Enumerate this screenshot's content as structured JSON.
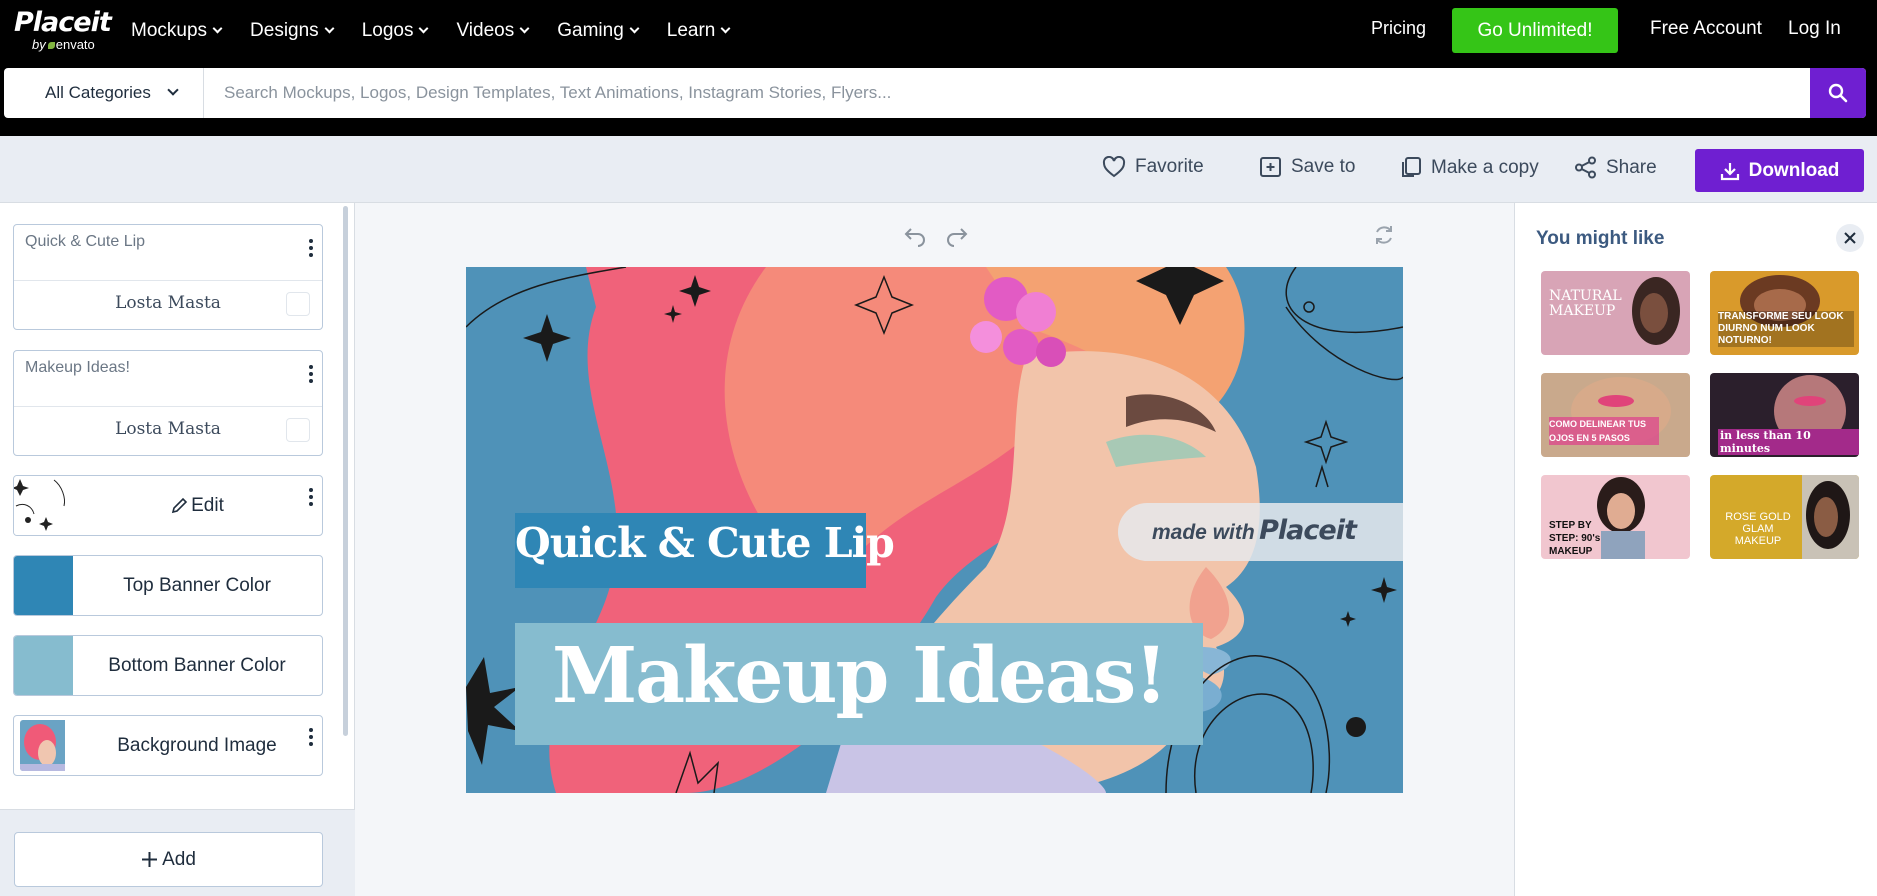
{
  "nav": {
    "logo_main": "Placeit",
    "logo_sub": "envato",
    "logo_by": "by",
    "menu": [
      "Mockups",
      "Designs",
      "Logos",
      "Videos",
      "Gaming",
      "Learn"
    ],
    "pricing": "Pricing",
    "cta": "Go Unlimited!",
    "free_account": "Free Account",
    "login": "Log In"
  },
  "search": {
    "category": "All Categories",
    "placeholder": "Search Mockups, Logos, Design Templates, Text Animations, Instagram Stories, Flyers..."
  },
  "toolbar": {
    "favorite": "Favorite",
    "save_to": "Save to",
    "make_copy": "Make a copy",
    "share": "Share",
    "download": "Download"
  },
  "left_panel": {
    "text_layers": [
      {
        "label": "Quick & Cute Lip",
        "font": "Losta Masta"
      },
      {
        "label": "Makeup Ideas!",
        "font": "Losta Masta"
      }
    ],
    "edit_label": "Edit",
    "top_banner": {
      "label": "Top Banner Color",
      "color": "#2f86b5"
    },
    "bottom_banner": {
      "label": "Bottom Banner Color",
      "color": "#86bccf"
    },
    "background_image": "Background Image",
    "add_label": "Add"
  },
  "design": {
    "headline_small": "Quick & Cute Lip",
    "headline_big": "Makeup Ideas!",
    "watermark_prefix": "made with",
    "watermark_brand": "Placeit",
    "bg_color": "#4f92b8",
    "top_banner_color": "#2f86b5",
    "bottom_banner_color": "#86bccf"
  },
  "right_panel": {
    "title": "You might like",
    "suggestions": [
      {
        "text": "NATURAL MAKEUP",
        "bg": "#d8a4b6"
      },
      {
        "text": "TRANSFORME SEU LOOK DIURNO NUM LOOK NOTURNO!",
        "bg": "#d99a2b"
      },
      {
        "text": "COMO DELINEAR TUS OJOS EN 5 PASOS",
        "bg": "#c9a98c"
      },
      {
        "text": "in less than 10 minutes",
        "bg": "#2b1f2c"
      },
      {
        "text": "STEP BY STEP: 90's MAKEUP",
        "bg": "#f1c6cf"
      },
      {
        "text": "ROSE GOLD GLAM MAKEUP",
        "bg": "#d4a92a"
      }
    ]
  }
}
